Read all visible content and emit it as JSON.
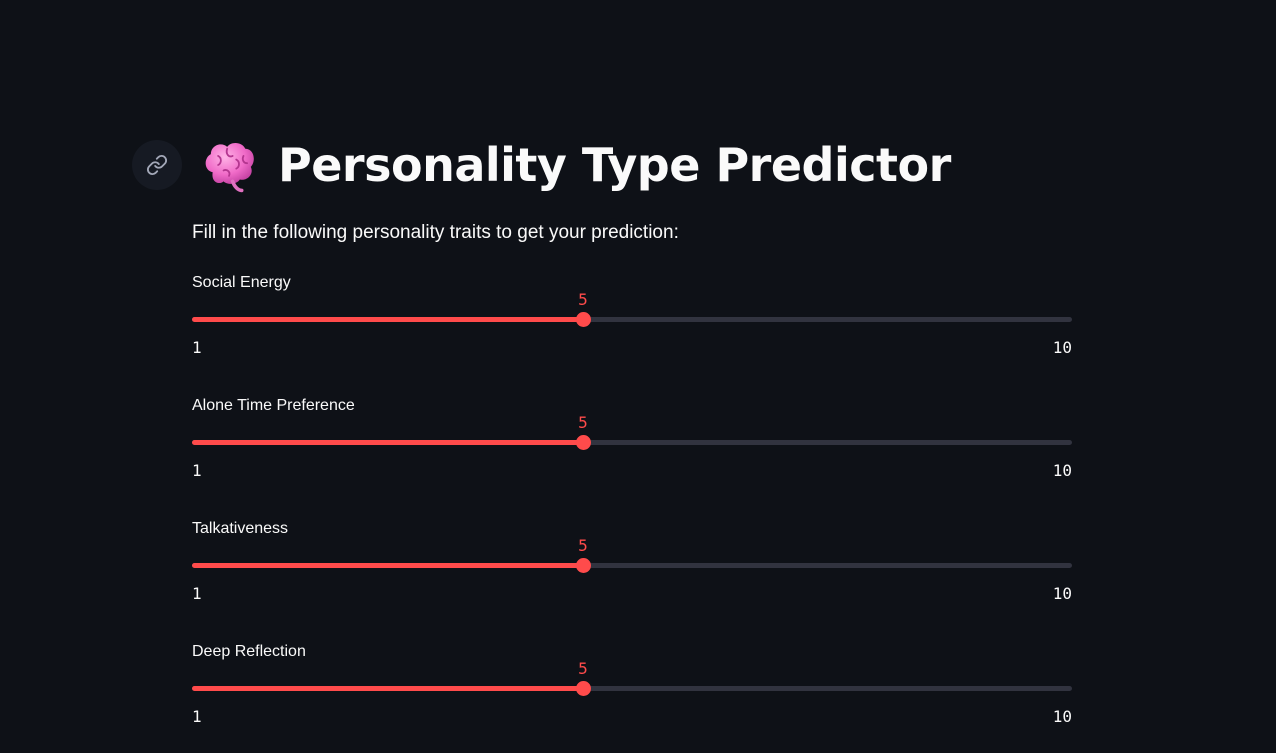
{
  "header": {
    "title": "Personality Type Predictor",
    "icon": "brain-icon",
    "anchor_icon": "link-icon"
  },
  "intro": "Fill in the following personality traits to get your prediction:",
  "sliders": [
    {
      "label": "Social Energy",
      "value": "5",
      "min": "1",
      "max": "10"
    },
    {
      "label": "Alone Time Preference",
      "value": "5",
      "min": "1",
      "max": "10"
    },
    {
      "label": "Talkativeness",
      "value": "5",
      "min": "1",
      "max": "10"
    },
    {
      "label": "Deep Reflection",
      "value": "5",
      "min": "1",
      "max": "10"
    }
  ],
  "colors": {
    "background": "#0e1117",
    "accent": "#ff4b4b",
    "track": "#31333f",
    "text": "#fafafa"
  }
}
